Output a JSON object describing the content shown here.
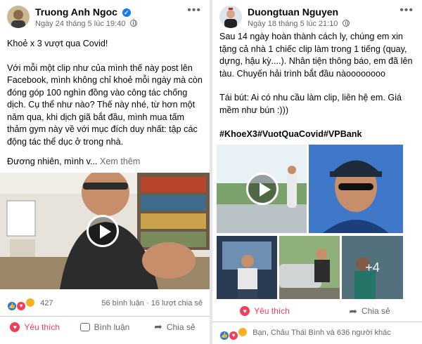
{
  "left_post": {
    "author": "Truong Anh Ngoc",
    "date": "Ngày 24 tháng 5 lúc 19:40",
    "menu": "•••",
    "title_line": "Khoẻ x 3 vượt qua Covid!",
    "paragraph": "Với mỗi một clip như của mình thế này post lên Facebook, mình không chỉ khoẻ mỗi ngày mà còn đóng góp 100 nghìn đồng vào công tác chống dịch. Cụ thể như nào? Thế này nhé, từ hơn một năm qua, khi dịch giã bắt đầu, mình mua tấm thảm gym này về với mục đích duy nhất: tập các động tác thể dục ở trong nhà.",
    "truncated": "Đương nhiên, mình v...",
    "see_more": "Xem thêm",
    "reaction_count": "427",
    "comments": "56 bình luận",
    "shares": "16 lượt chia sẻ",
    "actions": {
      "love": "Yêu thích",
      "comment": "Bình luận",
      "share": "Chia sẻ"
    }
  },
  "right_post": {
    "author": "Duongtuan Nguyen",
    "date": "Ngày 18 tháng 5 lúc 21:10",
    "menu": "•••",
    "paragraph1": "Sau 14 ngày hoàn thành cách ly, chúng em xin tặng cả nhà 1 chiếc clip làm trong 1 tiếng (quay, dựng, hậu kỳ....). Nhân tiện thông báo, em đã lên tàu. Chuyến hải trình bắt đầu nàoooooooo",
    "paragraph2": "Tái bút: Ai có nhu cầu làm clip, liên hệ em. Giá mềm như bún :)))",
    "hashtags": "#KhoeX3#VuotQuaCovid#VPBank",
    "more_photos": "+4",
    "actions": {
      "love": "Yêu thích",
      "share": "Chia sẻ"
    },
    "reactions_text": "Bạn, Châu Thái Bình và 636 người khác"
  },
  "colors": {
    "brand_blue": "#1877f2",
    "love_red": "#f33e58",
    "muted": "#65676b"
  },
  "icons": [
    "verified-icon",
    "globe-icon",
    "play-icon",
    "heart-icon",
    "comment-icon",
    "share-icon",
    "like-reaction-icon",
    "love-reaction-icon",
    "haha-reaction-icon"
  ]
}
